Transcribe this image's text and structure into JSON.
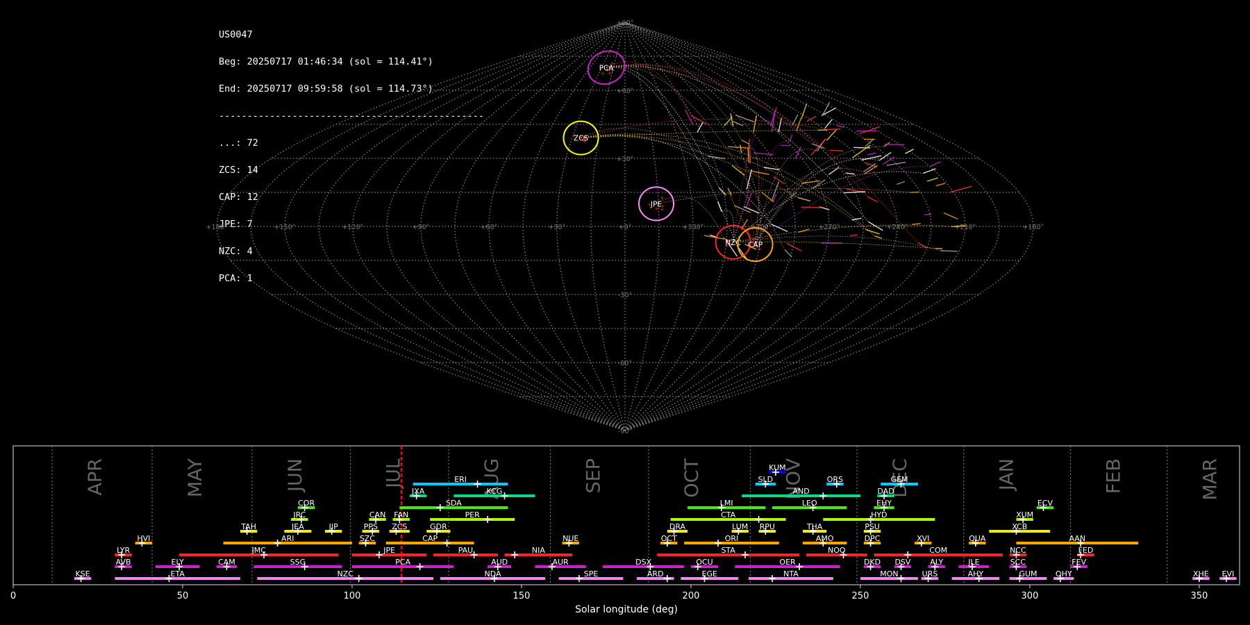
{
  "header": {
    "station": "US0047",
    "begin": "Beg: 20250717 01:46:34 (sol = 114.41°)",
    "end": "End: 20250717 09:59:58 (sol = 114.73°)",
    "separator": "-----------------------------------------------",
    "counts": [
      {
        "code": "...",
        "count": 72,
        "text": "...: 72"
      },
      {
        "code": "ZCS",
        "count": 14,
        "text": "ZCS: 14"
      },
      {
        "code": "CAP",
        "count": 12,
        "text": "CAP: 12"
      },
      {
        "code": "JPE",
        "count": 7,
        "text": "JPE: 7"
      },
      {
        "code": "NZC",
        "count": 4,
        "text": "NZC: 4"
      },
      {
        "code": "PCA",
        "count": 1,
        "text": "PCA: 1"
      }
    ]
  },
  "chart_data": [
    {
      "type": "scatter",
      "projection": "sinusoidal",
      "lon_tick_labels": [
        "+180°",
        "+150°",
        "+120°",
        "+90°",
        "+60°",
        "+30°",
        "+0°",
        "+330°",
        "+300°",
        "+270°",
        "+240°",
        "+210°",
        "+180°"
      ],
      "lat_tick_labels": [
        {
          "lat": 90,
          "text": "+90°"
        },
        {
          "lat": 60,
          "text": "+60°"
        },
        {
          "lat": 30,
          "text": "+30°"
        },
        {
          "lat": -30,
          "text": "-30°"
        },
        {
          "lat": -60,
          "text": "-60°"
        },
        {
          "lat": -90,
          "text": "-90°"
        }
      ],
      "radiants": [
        {
          "code": "PCA",
          "lon": 24,
          "lat": 70,
          "color": "#cc22cc",
          "radius": 0.4
        },
        {
          "code": "ZCS",
          "lon": 25,
          "lat": 39,
          "color": "#ffff00",
          "radius": 0.6
        },
        {
          "code": "JPE",
          "lon": 346,
          "lat": 10,
          "color": "#ff88ff",
          "radius": 0.6
        },
        {
          "code": "NZC",
          "lon": 312,
          "lat": -7,
          "color": "#ff2222",
          "radius": 0.6
        },
        {
          "code": "CAP",
          "lon": 302,
          "lat": -8,
          "color": "#ffa500",
          "radius": 0.6
        }
      ],
      "grid": true
    },
    {
      "type": "timeline",
      "xlabel": "Solar longitude (deg)",
      "xlim": [
        0,
        362
      ],
      "x_ticks": [
        0,
        50,
        100,
        150,
        200,
        250,
        300,
        350
      ],
      "current_sol": 114.6,
      "months": [
        {
          "name": "APR",
          "at": 11.5,
          "label_at": 24.5
        },
        {
          "name": "MAY",
          "at": 41,
          "label_at": 54
        },
        {
          "name": "JUN",
          "at": 70.5,
          "label_at": 83.5
        },
        {
          "name": "JUL",
          "at": 99.5,
          "label_at": 112.5
        },
        {
          "name": "AUG",
          "at": 128.5,
          "label_at": 141.5
        },
        {
          "name": "SEP",
          "at": 158.5,
          "label_at": 171.5
        },
        {
          "name": "OCT",
          "at": 187.5,
          "label_at": 200.5
        },
        {
          "name": "NOV",
          "at": 217.5,
          "label_at": 230.5
        },
        {
          "name": "DEC",
          "at": 249,
          "label_at": 262
        },
        {
          "name": "JAN",
          "at": 280.5,
          "label_at": 293.5
        },
        {
          "name": "FEB",
          "at": 312,
          "label_at": 325
        },
        {
          "name": "MAR",
          "at": 340.5,
          "label_at": 353.5
        }
      ],
      "showers": [
        {
          "code": "KUM",
          "row": 9,
          "start": 223,
          "end": 228,
          "peak": 225,
          "color": "#0000ff"
        },
        {
          "code": "ERI",
          "row": 8,
          "start": 118,
          "end": 146,
          "peak": 137,
          "color": "#00ccff"
        },
        {
          "code": "SLD",
          "row": 8,
          "start": 219,
          "end": 225,
          "peak": 222,
          "color": "#00ccff"
        },
        {
          "code": "ORS",
          "row": 8,
          "start": 240,
          "end": 245,
          "peak": 243,
          "color": "#00ccff"
        },
        {
          "code": "GEM",
          "row": 8,
          "start": 256,
          "end": 267,
          "peak": 262,
          "color": "#00ccff"
        },
        {
          "code": "JXA",
          "row": 7,
          "start": 117,
          "end": 122,
          "peak": 119,
          "color": "#00dd88"
        },
        {
          "code": "KCG",
          "row": 7,
          "start": 130,
          "end": 154,
          "peak": 145,
          "color": "#00dd88"
        },
        {
          "code": "AND",
          "row": 7,
          "start": 215,
          "end": 250,
          "peak": 239,
          "color": "#00dd88"
        },
        {
          "code": "DAD",
          "row": 7,
          "start": 255,
          "end": 260,
          "peak": 257,
          "color": "#00dd88"
        },
        {
          "code": "COR",
          "row": 6,
          "start": 84,
          "end": 89,
          "peak": 86,
          "color": "#44ee00"
        },
        {
          "code": "SDA",
          "row": 6,
          "start": 114,
          "end": 146,
          "peak": 126,
          "color": "#44ee00"
        },
        {
          "code": "LMI",
          "row": 6,
          "start": 199,
          "end": 222,
          "peak": 209,
          "color": "#44ee00"
        },
        {
          "code": "LEO",
          "row": 6,
          "start": 224,
          "end": 246,
          "peak": 236,
          "color": "#44ee00"
        },
        {
          "code": "EHY",
          "row": 6,
          "start": 254,
          "end": 260,
          "peak": 257,
          "color": "#44ee00"
        },
        {
          "code": "ECV",
          "row": 6,
          "start": 302,
          "end": 307,
          "peak": 304,
          "color": "#44ee00"
        },
        {
          "code": "JRC",
          "row": 5,
          "start": 82,
          "end": 87,
          "peak": 85,
          "color": "#aaff00"
        },
        {
          "code": "CAN",
          "row": 5,
          "start": 105,
          "end": 110,
          "peak": 107,
          "color": "#aaff00"
        },
        {
          "code": "FAN",
          "row": 5,
          "start": 112,
          "end": 117,
          "peak": 114,
          "color": "#aaff00"
        },
        {
          "code": "PER",
          "row": 5,
          "start": 123,
          "end": 148,
          "peak": 140,
          "color": "#aaff00"
        },
        {
          "code": "CTA",
          "row": 5,
          "start": 194,
          "end": 228,
          "peak": 220,
          "color": "#aaff00"
        },
        {
          "code": "HYD",
          "row": 5,
          "start": 239,
          "end": 272,
          "peak": 253,
          "color": "#aaff00"
        },
        {
          "code": "XUM",
          "row": 5,
          "start": 296,
          "end": 301,
          "peak": 298,
          "color": "#aaff00"
        },
        {
          "code": "TAH",
          "row": 4,
          "start": 67,
          "end": 72,
          "peak": 69,
          "color": "#eeee00"
        },
        {
          "code": "JEA",
          "row": 4,
          "start": 80,
          "end": 88,
          "peak": 84,
          "color": "#eeee00"
        },
        {
          "code": "JIP",
          "row": 4,
          "start": 92,
          "end": 97,
          "peak": 94,
          "color": "#eeee00"
        },
        {
          "code": "PPS",
          "row": 4,
          "start": 103,
          "end": 108,
          "peak": 106,
          "color": "#eeee00"
        },
        {
          "code": "ZCS",
          "row": 4,
          "start": 111,
          "end": 117,
          "peak": 113,
          "color": "#eeee00"
        },
        {
          "code": "GDR",
          "row": 4,
          "start": 122,
          "end": 129,
          "peak": 125,
          "color": "#eeee00"
        },
        {
          "code": "DRA",
          "row": 4,
          "start": 193,
          "end": 199,
          "peak": 195,
          "color": "#eeee00"
        },
        {
          "code": "LUM",
          "row": 4,
          "start": 212,
          "end": 217,
          "peak": 214,
          "color": "#eeee00"
        },
        {
          "code": "RPU",
          "row": 4,
          "start": 220,
          "end": 225,
          "peak": 222,
          "color": "#eeee00"
        },
        {
          "code": "THA",
          "row": 4,
          "start": 233,
          "end": 240,
          "peak": 236,
          "color": "#eeee00"
        },
        {
          "code": "PSU",
          "row": 4,
          "start": 251,
          "end": 256,
          "peak": 253,
          "color": "#eeee00"
        },
        {
          "code": "XCB",
          "row": 4,
          "start": 288,
          "end": 306,
          "peak": 296,
          "color": "#eeee00"
        },
        {
          "code": "HVI",
          "row": 3,
          "start": 36,
          "end": 41,
          "peak": 38,
          "color": "#ffa500"
        },
        {
          "code": "ARI",
          "row": 3,
          "start": 62,
          "end": 100,
          "peak": 78,
          "color": "#ffa500"
        },
        {
          "code": "SZC",
          "row": 3,
          "start": 102,
          "end": 107,
          "peak": 104,
          "color": "#ffa500"
        },
        {
          "code": "CAP",
          "row": 3,
          "start": 110,
          "end": 136,
          "peak": 128,
          "color": "#ffa500"
        },
        {
          "code": "NUE",
          "row": 3,
          "start": 162,
          "end": 167,
          "peak": 164,
          "color": "#ffa500"
        },
        {
          "code": "OCT",
          "row": 3,
          "start": 191,
          "end": 196,
          "peak": 193,
          "color": "#ffa500"
        },
        {
          "code": "ORI",
          "row": 3,
          "start": 198,
          "end": 226,
          "peak": 208,
          "color": "#ffa500"
        },
        {
          "code": "AMO",
          "row": 3,
          "start": 233,
          "end": 246,
          "peak": 239,
          "color": "#ffa500"
        },
        {
          "code": "DPC",
          "row": 3,
          "start": 251,
          "end": 256,
          "peak": 253,
          "color": "#ffa500"
        },
        {
          "code": "XVI",
          "row": 3,
          "start": 266,
          "end": 271,
          "peak": 268,
          "color": "#ffa500"
        },
        {
          "code": "QUA",
          "row": 3,
          "start": 282,
          "end": 287,
          "peak": 284,
          "color": "#ffa500"
        },
        {
          "code": "AAN",
          "row": 3,
          "start": 296,
          "end": 332,
          "peak": 315,
          "color": "#ffa500"
        },
        {
          "code": "LYR",
          "row": 2,
          "start": 30,
          "end": 35,
          "peak": 32,
          "color": "#ff2222"
        },
        {
          "code": "JMC",
          "row": 2,
          "start": 49,
          "end": 96,
          "peak": 74,
          "color": "#ff2222"
        },
        {
          "code": "JPE",
          "row": 2,
          "start": 100,
          "end": 122,
          "peak": 108,
          "color": "#ff2222"
        },
        {
          "code": "PAU",
          "row": 2,
          "start": 124,
          "end": 143,
          "peak": 136,
          "color": "#ff2222"
        },
        {
          "code": "NIA",
          "row": 2,
          "start": 145,
          "end": 165,
          "peak": 148,
          "color": "#ff2222"
        },
        {
          "code": "STA",
          "row": 2,
          "start": 190,
          "end": 232,
          "peak": 216,
          "color": "#ff2222"
        },
        {
          "code": "NOO",
          "row": 2,
          "start": 234,
          "end": 252,
          "peak": 245,
          "color": "#ff2222"
        },
        {
          "code": "COM",
          "row": 2,
          "start": 254,
          "end": 292,
          "peak": 264,
          "color": "#ff2222"
        },
        {
          "code": "NCC",
          "row": 2,
          "start": 294,
          "end": 299,
          "peak": 296,
          "color": "#ff2222"
        },
        {
          "code": "FED",
          "row": 2,
          "start": 314,
          "end": 319,
          "peak": 315,
          "color": "#ff2222"
        },
        {
          "code": "AVB",
          "row": 1,
          "start": 30,
          "end": 35,
          "peak": 32,
          "color": "#cc22cc"
        },
        {
          "code": "ELY",
          "row": 1,
          "start": 42,
          "end": 55,
          "peak": 49,
          "color": "#cc22cc"
        },
        {
          "code": "CAM",
          "row": 1,
          "start": 60,
          "end": 66,
          "peak": 63,
          "color": "#cc22cc"
        },
        {
          "code": "SSG",
          "row": 1,
          "start": 71,
          "end": 97,
          "peak": 86,
          "color": "#cc22cc"
        },
        {
          "code": "PCA",
          "row": 1,
          "start": 100,
          "end": 130,
          "peak": 120,
          "color": "#cc22cc"
        },
        {
          "code": "AUD",
          "row": 1,
          "start": 140,
          "end": 147,
          "peak": 143,
          "color": "#cc22cc"
        },
        {
          "code": "AUR",
          "row": 1,
          "start": 154,
          "end": 169,
          "peak": 159,
          "color": "#cc22cc"
        },
        {
          "code": "DSX",
          "row": 1,
          "start": 174,
          "end": 198,
          "peak": 188,
          "color": "#cc22cc"
        },
        {
          "code": "OCU",
          "row": 1,
          "start": 200,
          "end": 208,
          "peak": 202,
          "color": "#cc22cc"
        },
        {
          "code": "OER",
          "row": 1,
          "start": 213,
          "end": 244,
          "peak": 232,
          "color": "#cc22cc"
        },
        {
          "code": "DKD",
          "row": 1,
          "start": 251,
          "end": 256,
          "peak": 253,
          "color": "#cc22cc"
        },
        {
          "code": "DSV",
          "row": 1,
          "start": 260,
          "end": 265,
          "peak": 262,
          "color": "#cc22cc"
        },
        {
          "code": "ALY",
          "row": 1,
          "start": 270,
          "end": 275,
          "peak": 272,
          "color": "#cc22cc"
        },
        {
          "code": "JLE",
          "row": 1,
          "start": 279,
          "end": 288,
          "peak": 283,
          "color": "#cc22cc"
        },
        {
          "code": "SCC",
          "row": 1,
          "start": 294,
          "end": 299,
          "peak": 296,
          "color": "#cc22cc"
        },
        {
          "code": "FEV",
          "row": 1,
          "start": 312,
          "end": 317,
          "peak": 314,
          "color": "#cc22cc"
        },
        {
          "code": "KSE",
          "row": 0,
          "start": 18,
          "end": 23,
          "peak": 20,
          "color": "#ee88ee"
        },
        {
          "code": "ETA",
          "row": 0,
          "start": 30,
          "end": 67,
          "peak": 46,
          "color": "#ee88ee"
        },
        {
          "code": "NZC",
          "row": 0,
          "start": 72,
          "end": 124,
          "peak": 102,
          "color": "#ee88ee"
        },
        {
          "code": "NDA",
          "row": 0,
          "start": 126,
          "end": 157,
          "peak": 142,
          "color": "#ee88ee"
        },
        {
          "code": "SPE",
          "row": 0,
          "start": 161,
          "end": 180,
          "peak": 167,
          "color": "#ee88ee"
        },
        {
          "code": "ARD",
          "row": 0,
          "start": 184,
          "end": 195,
          "peak": 193,
          "color": "#ee88ee"
        },
        {
          "code": "EGE",
          "row": 0,
          "start": 197,
          "end": 214,
          "peak": 204,
          "color": "#ee88ee"
        },
        {
          "code": "NTA",
          "row": 0,
          "start": 217,
          "end": 242,
          "peak": 224,
          "color": "#ee88ee"
        },
        {
          "code": "MON",
          "row": 0,
          "start": 250,
          "end": 267,
          "peak": 262,
          "color": "#ee88ee"
        },
        {
          "code": "URS",
          "row": 0,
          "start": 268,
          "end": 273,
          "peak": 270,
          "color": "#ee88ee"
        },
        {
          "code": "AHY",
          "row": 0,
          "start": 277,
          "end": 291,
          "peak": 285,
          "color": "#ee88ee"
        },
        {
          "code": "GUM",
          "row": 0,
          "start": 294,
          "end": 305,
          "peak": 297,
          "color": "#ee88ee"
        },
        {
          "code": "OHY",
          "row": 0,
          "start": 307,
          "end": 313,
          "peak": 309,
          "color": "#ee88ee"
        },
        {
          "code": "XHE",
          "row": 0,
          "start": 348,
          "end": 353,
          "peak": 350,
          "color": "#ee88ee"
        },
        {
          "code": "EVI",
          "row": 0,
          "start": 356,
          "end": 361,
          "peak": 358,
          "color": "#ee88ee"
        }
      ]
    }
  ]
}
